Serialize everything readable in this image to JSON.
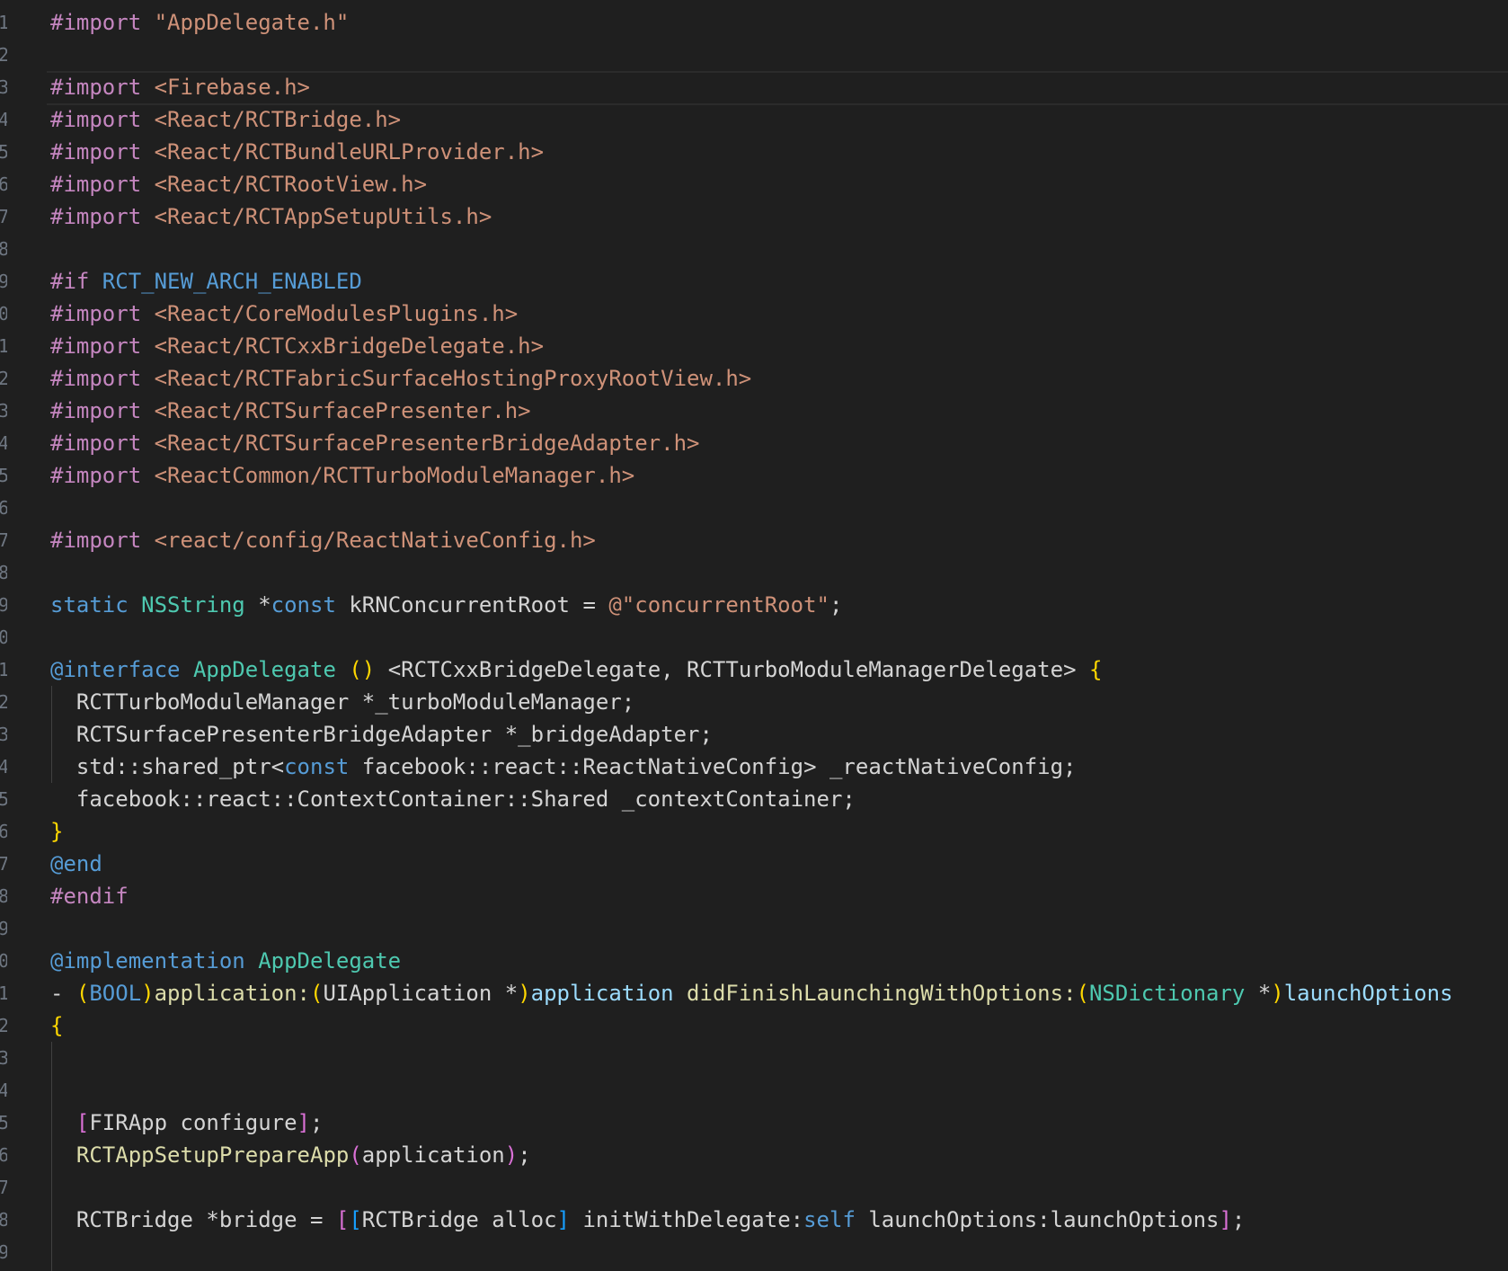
{
  "editor": {
    "line_numbers": [
      "1",
      "2",
      "3",
      "4",
      "5",
      "6",
      "7",
      "8",
      "9",
      "0",
      "1",
      "2",
      "3",
      "4",
      "5",
      "6",
      "7",
      "8",
      "9",
      "0",
      "1",
      "2",
      "3",
      "4",
      "5",
      "6",
      "7",
      "8",
      "9",
      "0",
      "1",
      "2",
      "3",
      "4",
      "5",
      "6",
      "7",
      "8",
      "9"
    ],
    "lines": [
      [
        {
          "t": "#import ",
          "c": "kw-import"
        },
        {
          "t": "\"AppDelegate.h\"",
          "c": "str"
        }
      ],
      [],
      [
        {
          "t": "#import ",
          "c": "kw-import"
        },
        {
          "t": "<Firebase.h>",
          "c": "str"
        }
      ],
      [
        {
          "t": "#import ",
          "c": "kw-import"
        },
        {
          "t": "<React/RCTBridge.h>",
          "c": "str"
        }
      ],
      [
        {
          "t": "#import ",
          "c": "kw-import"
        },
        {
          "t": "<React/RCTBundleURLProvider.h>",
          "c": "str"
        }
      ],
      [
        {
          "t": "#import ",
          "c": "kw-import"
        },
        {
          "t": "<React/RCTRootView.h>",
          "c": "str"
        }
      ],
      [
        {
          "t": "#import ",
          "c": "kw-import"
        },
        {
          "t": "<React/RCTAppSetupUtils.h>",
          "c": "str"
        }
      ],
      [],
      [
        {
          "t": "#if ",
          "c": "kw-import"
        },
        {
          "t": "RCT_NEW_ARCH_ENABLED",
          "c": "macro"
        }
      ],
      [
        {
          "t": "#import ",
          "c": "kw-import"
        },
        {
          "t": "<React/CoreModulesPlugins.h>",
          "c": "str"
        }
      ],
      [
        {
          "t": "#import ",
          "c": "kw-import"
        },
        {
          "t": "<React/RCTCxxBridgeDelegate.h>",
          "c": "str"
        }
      ],
      [
        {
          "t": "#import ",
          "c": "kw-import"
        },
        {
          "t": "<React/RCTFabricSurfaceHostingProxyRootView.h>",
          "c": "str"
        }
      ],
      [
        {
          "t": "#import ",
          "c": "kw-import"
        },
        {
          "t": "<React/RCTSurfacePresenter.h>",
          "c": "str"
        }
      ],
      [
        {
          "t": "#import ",
          "c": "kw-import"
        },
        {
          "t": "<React/RCTSurfacePresenterBridgeAdapter.h>",
          "c": "str"
        }
      ],
      [
        {
          "t": "#import ",
          "c": "kw-import"
        },
        {
          "t": "<ReactCommon/RCTTurboModuleManager.h>",
          "c": "str"
        }
      ],
      [],
      [
        {
          "t": "#import ",
          "c": "kw-import"
        },
        {
          "t": "<react/config/ReactNativeConfig.h>",
          "c": "str"
        }
      ],
      [],
      [
        {
          "t": "static ",
          "c": "storage"
        },
        {
          "t": "NSString ",
          "c": "type"
        },
        {
          "t": "*",
          "c": "ident"
        },
        {
          "t": "const ",
          "c": "storage"
        },
        {
          "t": "kRNConcurrentRoot = ",
          "c": "ident"
        },
        {
          "t": "@\"concurrentRoot\"",
          "c": "str"
        },
        {
          "t": ";",
          "c": "ident"
        }
      ],
      [],
      [
        {
          "t": "@interface ",
          "c": "storage"
        },
        {
          "t": "AppDelegate ",
          "c": "type"
        },
        {
          "t": "() ",
          "c": "brace"
        },
        {
          "t": "<RCTCxxBridgeDelegate, RCTTurboModuleManagerDelegate> ",
          "c": "ident"
        },
        {
          "t": "{",
          "c": "brace"
        }
      ],
      [
        {
          "t": "  RCTTurboModuleManager *_turboModuleManager;",
          "c": "ident"
        }
      ],
      [
        {
          "t": "  RCTSurfacePresenterBridgeAdapter *_bridgeAdapter;",
          "c": "ident"
        }
      ],
      [
        {
          "t": "  std::shared_ptr<",
          "c": "ident"
        },
        {
          "t": "const ",
          "c": "storage"
        },
        {
          "t": "facebook::react::ReactNativeConfig> _reactNativeConfig;",
          "c": "ident"
        }
      ],
      [
        {
          "t": "  facebook::react::ContextContainer::Shared _contextContainer;",
          "c": "ident"
        }
      ],
      [
        {
          "t": "}",
          "c": "brace"
        }
      ],
      [
        {
          "t": "@end",
          "c": "storage"
        }
      ],
      [
        {
          "t": "#endif",
          "c": "kw-import"
        }
      ],
      [],
      [
        {
          "t": "@implementation ",
          "c": "storage"
        },
        {
          "t": "AppDelegate",
          "c": "type"
        }
      ],
      [
        {
          "t": "- ",
          "c": "ident"
        },
        {
          "t": "(",
          "c": "brace"
        },
        {
          "t": "BOOL",
          "c": "storage"
        },
        {
          "t": ")",
          "c": "brace"
        },
        {
          "t": "application:",
          "c": "func"
        },
        {
          "t": "(",
          "c": "brace"
        },
        {
          "t": "UIApplication *",
          "c": "ident"
        },
        {
          "t": ")",
          "c": "brace"
        },
        {
          "t": "application ",
          "c": "var"
        },
        {
          "t": "didFinishLaunchingWithOptions:",
          "c": "func"
        },
        {
          "t": "(",
          "c": "brace"
        },
        {
          "t": "NSDictionary ",
          "c": "type"
        },
        {
          "t": "*",
          "c": "ident"
        },
        {
          "t": ")",
          "c": "brace"
        },
        {
          "t": "launchOptions",
          "c": "var"
        }
      ],
      [
        {
          "t": "{",
          "c": "brace"
        }
      ],
      [],
      [],
      [
        {
          "t": "  ",
          "c": "ident"
        },
        {
          "t": "[",
          "c": "brk2"
        },
        {
          "t": "FIRApp configure",
          "c": "ident"
        },
        {
          "t": "]",
          "c": "brk2"
        },
        {
          "t": ";",
          "c": "ident"
        }
      ],
      [
        {
          "t": "  ",
          "c": "ident"
        },
        {
          "t": "RCTAppSetupPrepareApp",
          "c": "func"
        },
        {
          "t": "(",
          "c": "brk2"
        },
        {
          "t": "application",
          "c": "ident"
        },
        {
          "t": ")",
          "c": "brk2"
        },
        {
          "t": ";",
          "c": "ident"
        }
      ],
      [],
      [
        {
          "t": "  RCTBridge *bridge = ",
          "c": "ident"
        },
        {
          "t": "[",
          "c": "brk2"
        },
        {
          "t": "[",
          "c": "brk3"
        },
        {
          "t": "RCTBridge alloc",
          "c": "ident"
        },
        {
          "t": "]",
          "c": "brk3"
        },
        {
          "t": " initWithDelegate:",
          "c": "ident"
        },
        {
          "t": "self",
          "c": "storage"
        },
        {
          "t": " launchOptions:launchOptions",
          "c": "ident"
        },
        {
          "t": "]",
          "c": "brk2"
        },
        {
          "t": ";",
          "c": "ident"
        }
      ],
      []
    ]
  }
}
